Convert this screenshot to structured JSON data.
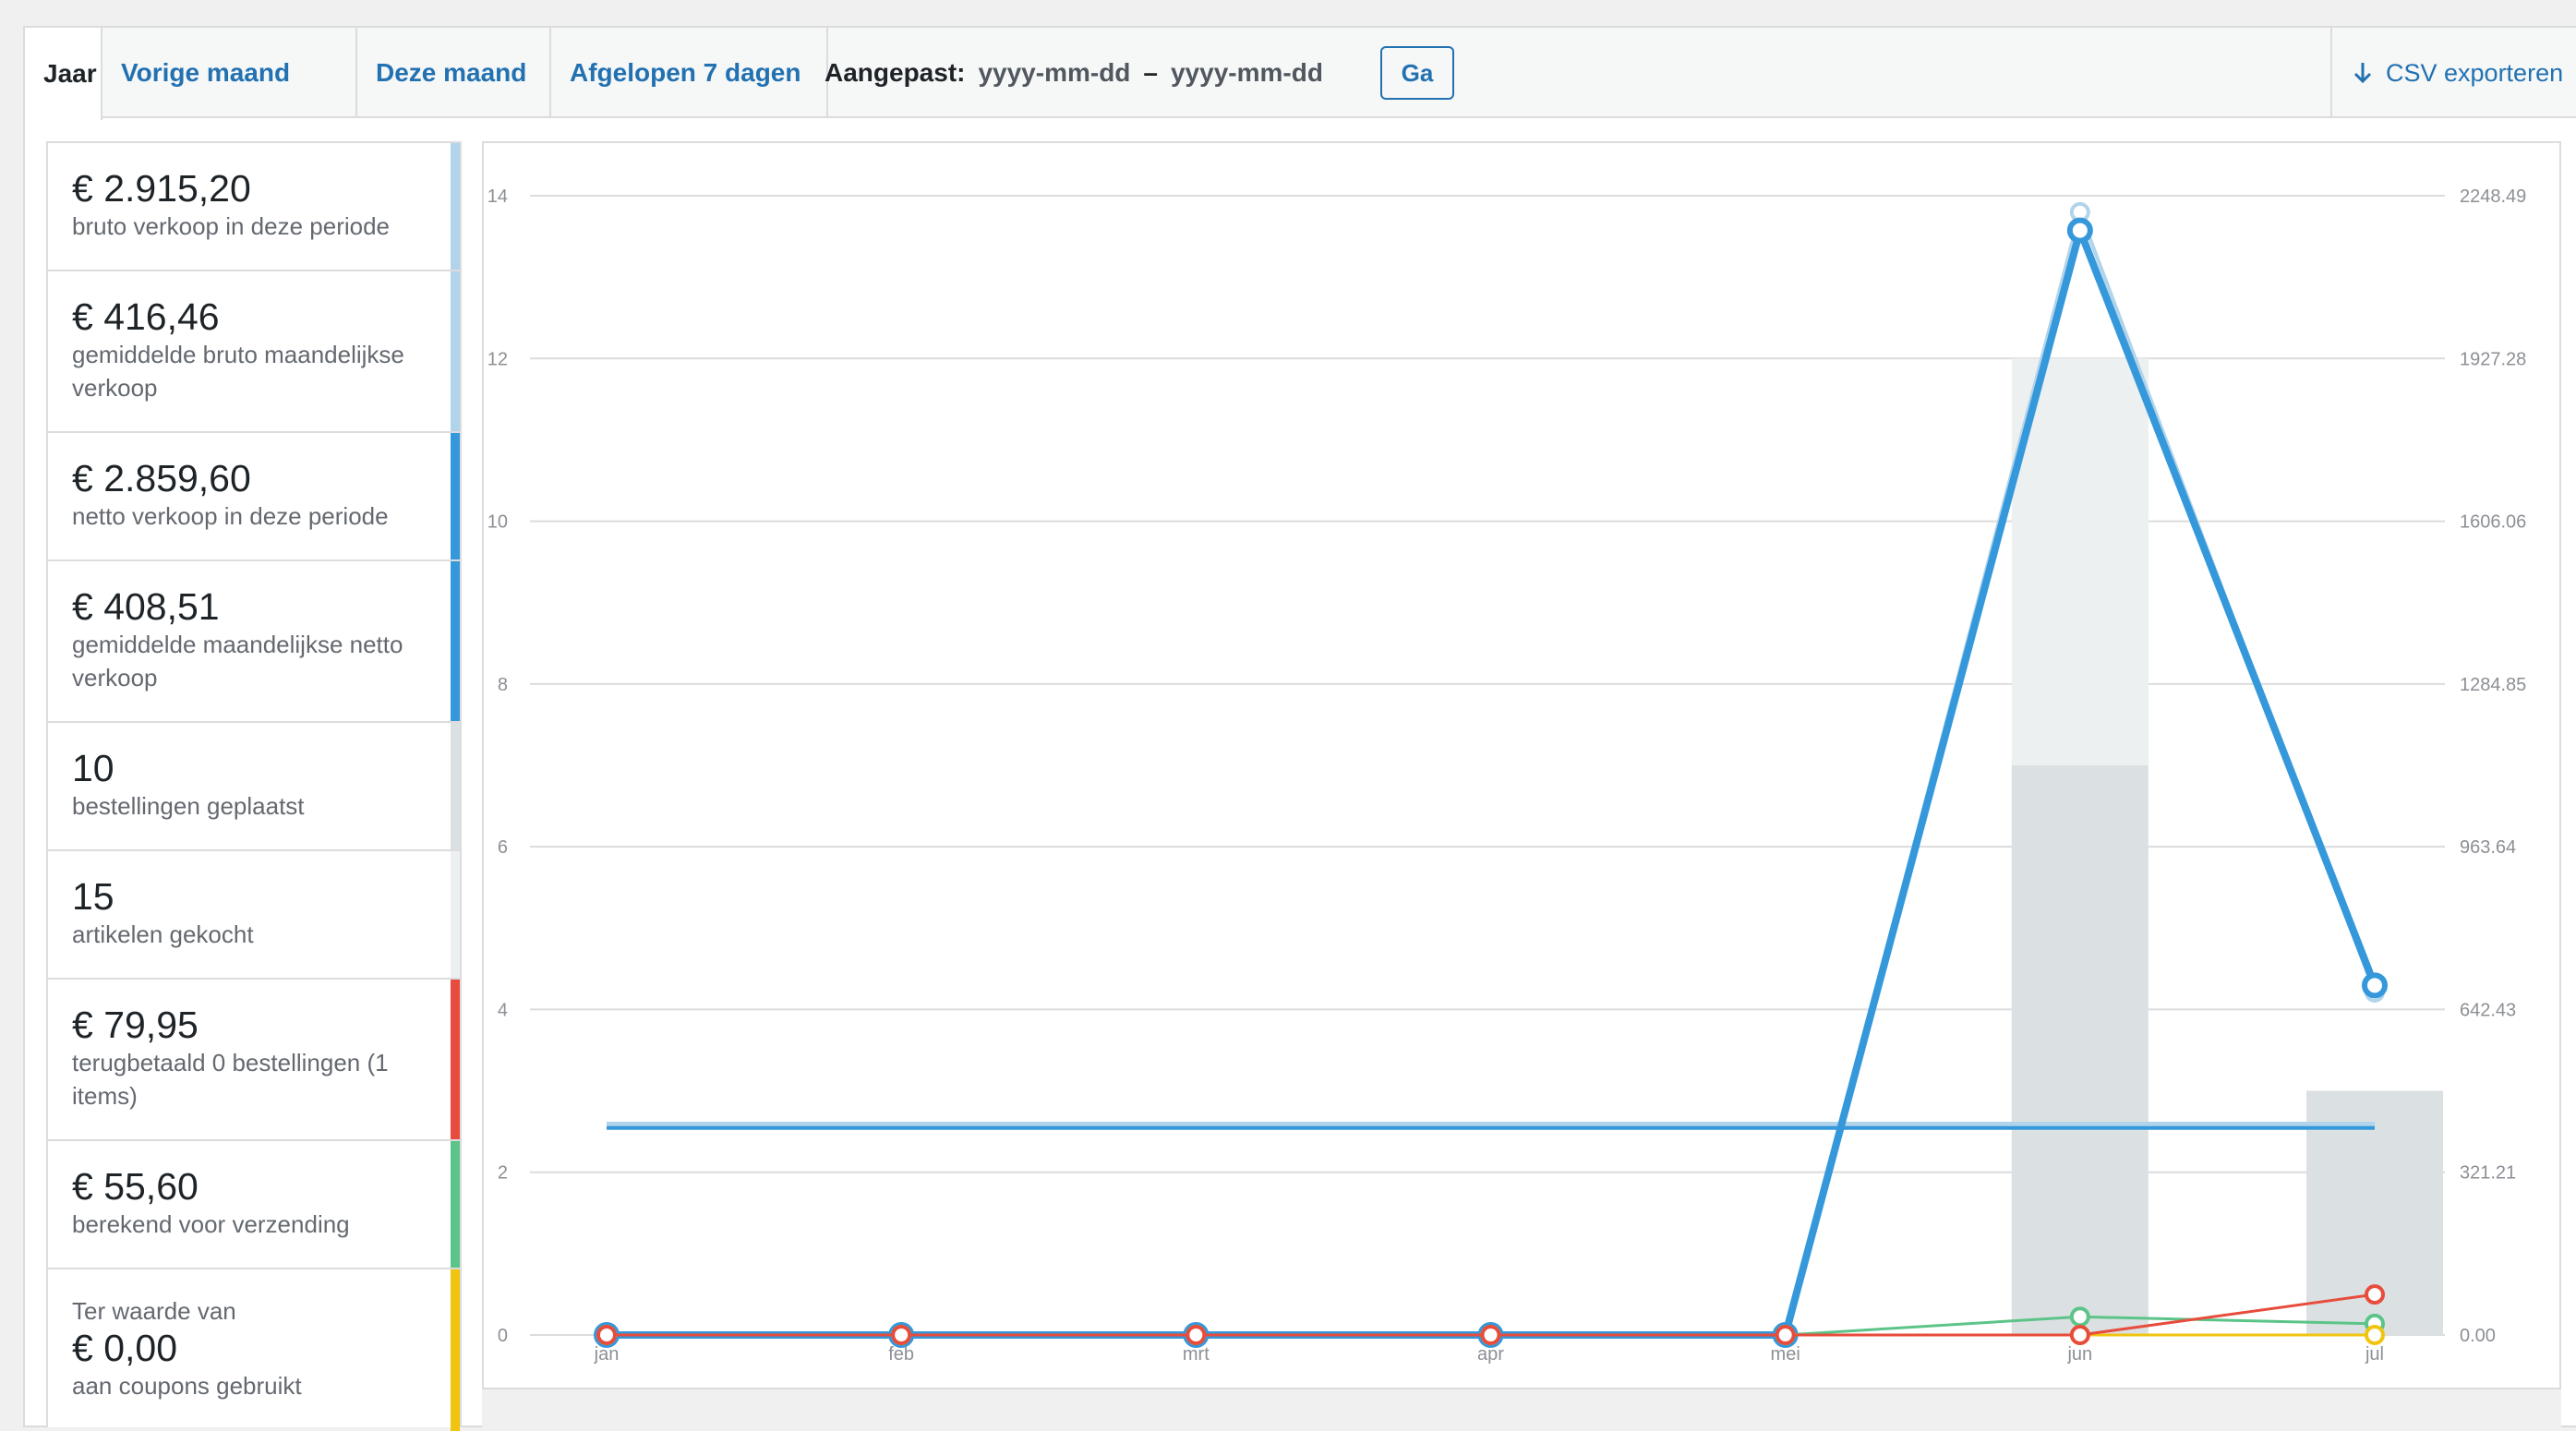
{
  "nav": {
    "tabs": [
      {
        "label": "Jaar",
        "active": true
      },
      {
        "label": "Vorige maand",
        "active": false
      },
      {
        "label": "Deze maand",
        "active": false
      },
      {
        "label": "Afgelopen 7 dagen",
        "active": false
      }
    ],
    "custom_label": "Aangepast:",
    "date_from_placeholder": "yyyy-mm-dd",
    "date_separator": "–",
    "date_to_placeholder": "yyyy-mm-dd",
    "go_label": "Ga",
    "export_label": "CSV exporteren",
    "export_icon": "download-arrow-icon"
  },
  "stats": [
    {
      "amount": "€ 2.915,20",
      "label": "bruto verkoop in deze periode",
      "color": "#b1d4ea"
    },
    {
      "amount": "€ 416,46",
      "label": "gemiddelde bruto maandelijkse verkoop",
      "color": "#b1d4ea"
    },
    {
      "amount": "€ 2.859,60",
      "label": "netto verkoop in deze periode",
      "color": "#3498db"
    },
    {
      "amount": "€ 408,51",
      "label": "gemiddelde maandelijkse netto verkoop",
      "color": "#3498db"
    },
    {
      "amount": "10",
      "label": "bestellingen geplaatst",
      "color": "#dbe1e3"
    },
    {
      "amount": "15",
      "label": "artikelen gekocht",
      "color": "#ecf0f1"
    },
    {
      "amount": "€ 79,95",
      "label": "terugbetaald 0 bestellingen (1 items)",
      "color": "#e74c3c"
    },
    {
      "amount": "€ 55,60",
      "label": "berekend voor verzending",
      "color": "#5cc488"
    },
    {
      "pre": "Ter waarde van",
      "amount": "€ 0,00",
      "label": "aan coupons gebruikt",
      "color": "#f1c40f"
    }
  ],
  "chart_data": {
    "type": "bar",
    "categories": [
      "jan",
      "feb",
      "mrt",
      "apr",
      "mei",
      "jun",
      "jul"
    ],
    "left_axis": {
      "ticks": [
        "0",
        "2",
        "4",
        "6",
        "8",
        "10",
        "12",
        "14"
      ],
      "ylim": [
        0,
        14
      ]
    },
    "right_axis": {
      "ticks": [
        "0.00",
        "321.21",
        "642.43",
        "963.64",
        "1284.85",
        "1606.06",
        "1927.28",
        "2248.49"
      ],
      "ylim": [
        0,
        2248.49
      ]
    },
    "grid": true,
    "bars": [
      {
        "axis": "left",
        "color": "#ecf0f1",
        "values": [
          0,
          0,
          0,
          0,
          0,
          12,
          3
        ]
      },
      {
        "axis": "left",
        "color": "#dbe1e3",
        "values": [
          0,
          0,
          0,
          0,
          0,
          7,
          3
        ]
      }
    ],
    "lines": [
      {
        "axis": "right",
        "color": "#b1d4ea",
        "width": 4,
        "markers": true,
        "values": [
          0,
          0,
          0,
          0,
          0,
          2216,
          676
        ]
      },
      {
        "axis": "right",
        "color": "#3498db",
        "width": 8,
        "markers": true,
        "values": [
          0,
          0,
          0,
          0,
          0,
          2180,
          690
        ]
      },
      {
        "axis": "right",
        "color": "#5cc488",
        "width": 3,
        "markers": true,
        "values": [
          0,
          0,
          0,
          0,
          0,
          36,
          22
        ]
      },
      {
        "axis": "right",
        "color": "#f1c40f",
        "width": 3,
        "markers": true,
        "values": [
          0,
          0,
          0,
          0,
          0,
          0,
          0
        ]
      },
      {
        "axis": "right",
        "color": "#e74c3c",
        "width": 3,
        "markers": true,
        "values": [
          0,
          0,
          0,
          0,
          0,
          0,
          80
        ]
      }
    ],
    "averages": [
      {
        "axis": "right",
        "color": "#b1d4ea",
        "value": 416.46
      },
      {
        "axis": "right",
        "color": "#3498db",
        "value": 408.51
      }
    ]
  }
}
